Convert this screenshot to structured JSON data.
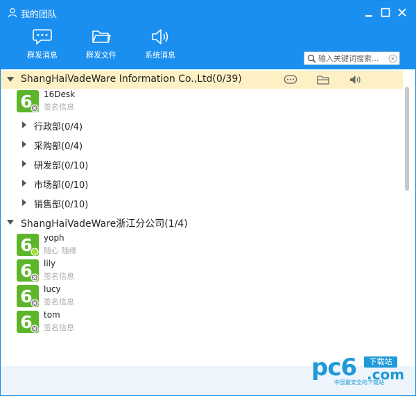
{
  "window": {
    "title": "我的团队"
  },
  "toolbar": {
    "group_message": "群发消息",
    "group_file": "群发文件",
    "system_message": "系统消息"
  },
  "search": {
    "placeholder": "输入关键词搜索..."
  },
  "groups": [
    {
      "name": "ShangHaiVadeWare Information Co.,Ltd(0/39)",
      "members": [
        {
          "name": "16Desk",
          "signature": "签名信息",
          "status": "offline"
        }
      ],
      "subgroups": [
        {
          "name": "行政部(0/4)"
        },
        {
          "name": "采购部(0/4)"
        },
        {
          "name": "研发部(0/10)"
        },
        {
          "name": "市场部(0/10)"
        },
        {
          "name": "销售部(0/10)"
        }
      ]
    },
    {
      "name": "ShangHaiVadeWare浙江分公司(1/4)",
      "members": [
        {
          "name": "yoph",
          "signature": "随心 随缘",
          "status": "online"
        },
        {
          "name": "lily",
          "signature": "签名信息",
          "status": "offline"
        },
        {
          "name": "lucy",
          "signature": "签名信息",
          "status": "offline"
        },
        {
          "name": "tom",
          "signature": "签名信息",
          "status": "offline"
        }
      ]
    }
  ],
  "watermark": {
    "brand": "pc6",
    "badge": "下载站",
    "domain": ".com",
    "tagline": "中国最安全的下载站"
  },
  "colors": {
    "header_bg": "#1b8ff0",
    "group_highlight": "#fdf0c4",
    "avatar_green": "#5db52a",
    "watermark_blue": "#1f9ad8"
  }
}
